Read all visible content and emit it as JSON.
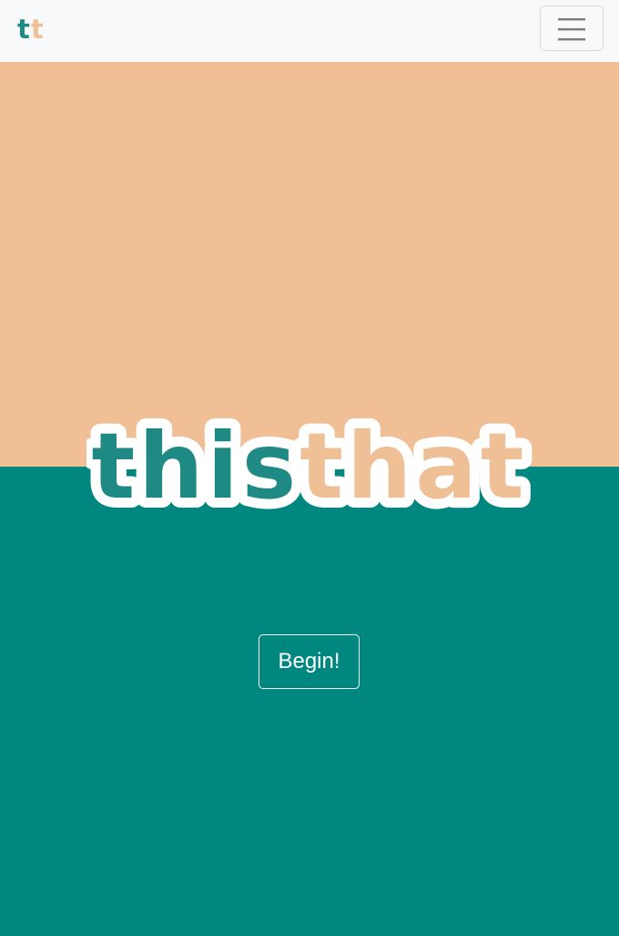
{
  "navbar": {
    "brand_part1": "t",
    "brand_part2": "t",
    "menu_icon": "hamburger-menu-icon"
  },
  "hero": {
    "logo_part1": "this",
    "logo_part2": "that",
    "begin_label": "Begin!"
  },
  "colors": {
    "teal": "#00877f",
    "peach": "#f0bf96",
    "logo_teal": "#1f8a84",
    "logo_peach": "#efbf96",
    "navbar_bg": "#f8f9fa"
  }
}
